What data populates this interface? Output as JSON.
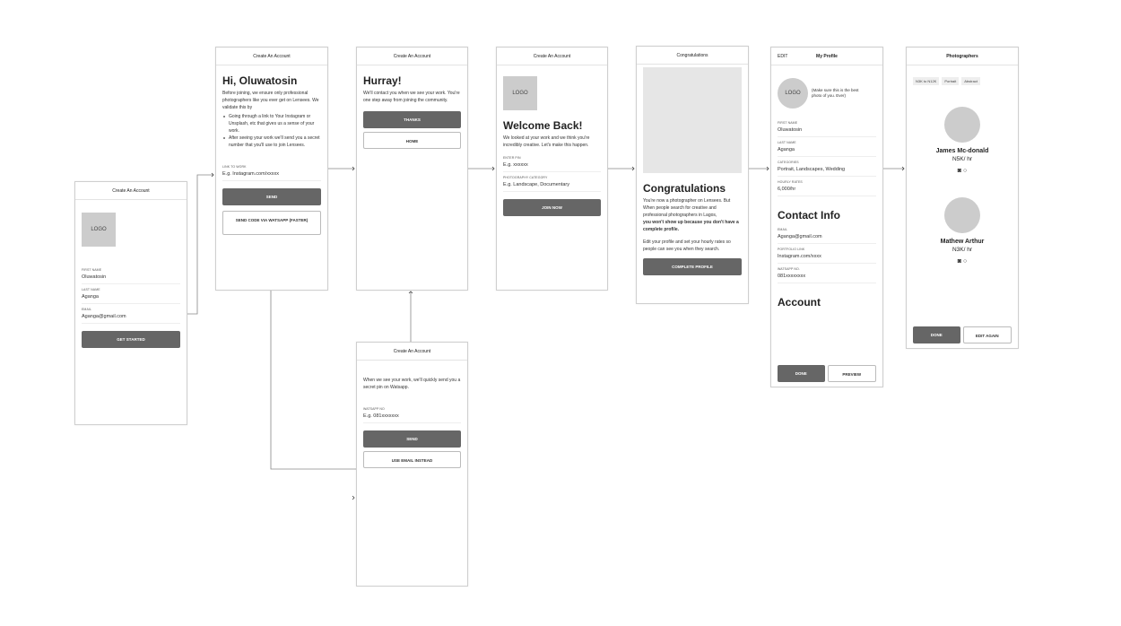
{
  "screens": {
    "signup": {
      "title": "Create An Account",
      "logo": "LOGO",
      "fields": [
        {
          "label": "First name",
          "value": "Oluwatosin"
        },
        {
          "label": "Last name",
          "value": "Aganga"
        },
        {
          "label": "Email",
          "value": "Aganga@gmail.com"
        }
      ],
      "button": "GET STARTED"
    },
    "intro": {
      "title": "Create An Account",
      "heading": "Hi, Oluwatosin",
      "text": "Before joining, we ensure only professional photographers like you ever get on Lensees. We validate this by",
      "bullets": [
        "Going through a link to Your Instagram or Unsplash, etc that gives us a sense of your work.",
        "After seeing your work we'll send you a secret number that you'll use to join Lensees."
      ],
      "field_label": "Link to work",
      "field_value": "E.g. Instagram.com/xxxxx",
      "send": "SEND",
      "whatsapp": "SEND CODE VIA WATSAPP (FASTER)"
    },
    "hurray": {
      "title": "Create An Account",
      "heading": "Hurray!",
      "text": "We'll contact you when we see your work. You're one step away from joining the community.",
      "thanks": "THANKS",
      "home": "HOME"
    },
    "whatsapp": {
      "title": "Create An Account",
      "text": "When we see your work, we'll quickly send you a secret pin on Watsapp.",
      "field_label": "Watsapp no",
      "field_value": "E.g. 081xxxxxxx",
      "send": "SEND",
      "email": "USE EMAIL INSTEAD"
    },
    "welcome": {
      "title": "Create An Account",
      "logo": "LOGO",
      "heading": "Welcome Back!",
      "text": "We looked at your work and we think you're incredibly creative. Let's make this happen.",
      "fields": [
        {
          "label": "Enter pin",
          "value": "E.g. xxxxxx"
        },
        {
          "label": "Photography category",
          "value": "E.g. Landscape, Documentary"
        }
      ],
      "button": "JOIN NOW"
    },
    "congrats": {
      "title": "Congratulations",
      "heading": "Congratulations",
      "text": "You're now a photographer on Lensees. But When people search for creative and professional photographers in Lagos,",
      "bold": "you won't show up because you don't have a complete profile.",
      "text2": "Edit your profile and set your hourly rates so people can see you when they search.",
      "button": "COMPLETE PROFILE"
    },
    "profile": {
      "edit": "EDIT",
      "title": "My Profile",
      "logo": "LOGO",
      "photo_note": "(Make sure this is the best photo of you. Ever)",
      "fields": [
        {
          "label": "First name",
          "value": "Oluwatosin"
        },
        {
          "label": "Last name",
          "value": "Aganga"
        },
        {
          "label": "Categories",
          "value": "Portrait, Landscapes, Wedding"
        },
        {
          "label": "Hourly rates",
          "value": "6,000/hr"
        }
      ],
      "contact_heading": "Contact Info",
      "contact_fields": [
        {
          "label": "Email",
          "value": "Aganga@gmail.com"
        },
        {
          "label": "Portfolio link",
          "value": "Instagram.com/xxxx"
        },
        {
          "label": "Watsapp no.",
          "value": "081xxxxxxxx"
        }
      ],
      "account_heading": "Account",
      "done": "DONE",
      "preview": "PREVIEW"
    },
    "photographers": {
      "title": "Photographers",
      "filters": [
        "N3K to N12K",
        "Portrait",
        "Abstract"
      ],
      "people": [
        {
          "name": "James Mc-donald",
          "rate": "N5K/ hr"
        },
        {
          "name": "Mathew Arthur",
          "rate": "N3K/ hr"
        }
      ],
      "done": "DONE",
      "edit_again": "EDIT AGAIN"
    }
  }
}
